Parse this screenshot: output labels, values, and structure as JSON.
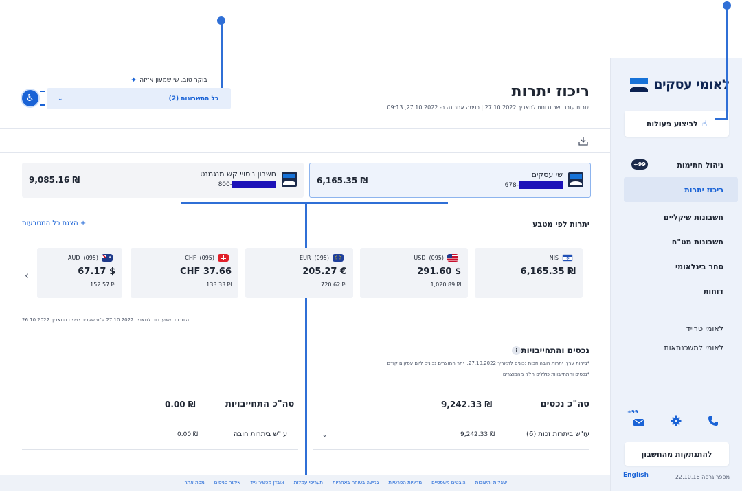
{
  "sidebar": {
    "logo_text": "לאומי עסקים",
    "action_button": "לביצוע פעולות",
    "items": [
      {
        "label": "ניהול חתימות",
        "badge": "+99"
      },
      {
        "label": "ריכוז יתרות"
      },
      {
        "label": "חשבונות שיקליים"
      },
      {
        "label": "חשבונות מט\"ח"
      },
      {
        "label": "סחר בינלאומי"
      },
      {
        "label": "דוחות"
      }
    ],
    "secondary_items": [
      {
        "label": "לאומי טרייד"
      },
      {
        "label": "לאומי למשכנתאות"
      }
    ],
    "mail_badge": "+99",
    "logout_button": "להתנתקות מהחשבון",
    "version": "מספר גרסה 22.10.16",
    "language_link": "English"
  },
  "header": {
    "title": "ריכוז יתרות",
    "subtitle": "יתרות עובר ושב נכונות לתאריך 27.10.2022 | כניסה אחרונה ב- 27.10.2022, 09:13",
    "greeting": "בוקר טוב, שי שמעון אזיזה",
    "account_select": "כל החשבונות (2)"
  },
  "accounts": [
    {
      "name": "שי עסקים",
      "number_suffix": "678-",
      "balance": "₪ 6,165.35"
    },
    {
      "name": "חשבון ניסויי קש מנגמנט",
      "number_suffix": "800-",
      "balance": "₪ 9,085.16"
    }
  ],
  "currencies": {
    "title": "יתרות לפי מטבע",
    "show_all": "+ הצגת כל המטבעות",
    "items": [
      {
        "code": "NIS",
        "branch": "",
        "main": "₪ 6,165.35",
        "sub": ""
      },
      {
        "code": "USD",
        "branch": "(095)",
        "main": "$ 291.60",
        "sub": "₪ 1,020.89"
      },
      {
        "code": "EUR",
        "branch": "(095)",
        "main": "€ 205.27",
        "sub": "₪ 720.62"
      },
      {
        "code": "CHF",
        "branch": "(095)",
        "main": "CHF 37.66",
        "sub": "₪ 133.33"
      },
      {
        "code": "AUD",
        "branch": "(095)",
        "main": "$ 67.17",
        "sub": "₪ 152.57"
      }
    ],
    "rate_note": "היתרות משוערכות לתאריך 27.10.2022 ע\"פ שערים יציגים מתאריך 26.10.2022"
  },
  "assets": {
    "title": "נכסים והתחייבויות",
    "info_icon": "i",
    "note1": "*ניירות ערך, יתרות חובה וזכות נכונים לתאריך 27.10.2022., יתר המוצרים נכונים ליום עסקים קודם",
    "note2": "*נכסים והתחייבויות כוללים חלק מהמוצרים",
    "total_assets_label": "סה\"כ נכסים",
    "total_assets_value": "₪ 9,242.33",
    "total_liabilities_label": "סה\"כ התחייבויות",
    "total_liabilities_value": "₪ 0.00",
    "credit_label": "עו\"ש ביתרות זכות (6)",
    "credit_value": "₪ 9,242.33",
    "debit_label": "עו\"ש ביתרות חובה",
    "debit_value": "₪ 0.00"
  },
  "footer": {
    "links": [
      "שאלות ותשובות",
      "היבטים משפטיים",
      "מדיניות הפרטיות",
      "גלישה בטוחה באחריות",
      "תעריפי עמלות",
      "אובדן מכשיר נייד",
      "איתור סניפים",
      "מפת אתר"
    ]
  },
  "colors": {
    "accent": "#1a63d6",
    "sidebar_bg": "#edf2fa",
    "navy": "#0f2552",
    "annotation": "#2f6fd6"
  }
}
